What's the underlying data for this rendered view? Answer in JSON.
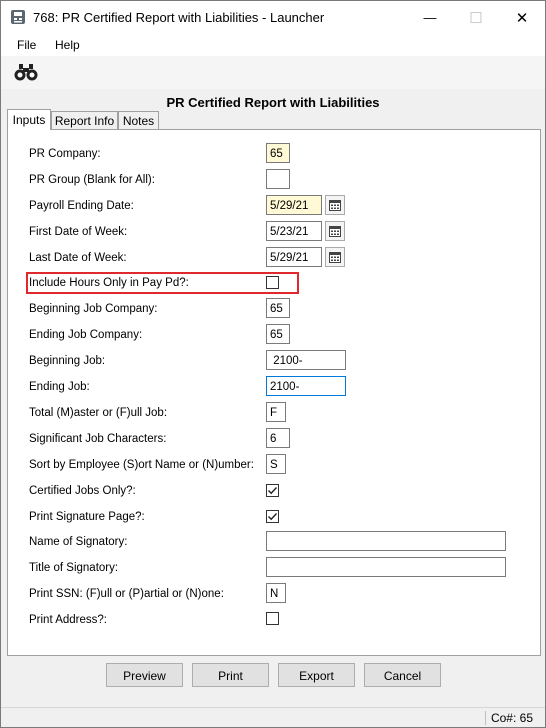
{
  "window": {
    "title": "768: PR Certified Report with Liabilities - Launcher",
    "min_glyph": "—",
    "max_glyph": "☐",
    "close_glyph": "✕"
  },
  "menu": {
    "file": "File",
    "help": "Help"
  },
  "report_title": "PR Certified Report with Liabilities",
  "tabs": [
    {
      "label": "Inputs"
    },
    {
      "label": "Report Info"
    },
    {
      "label": "Notes"
    }
  ],
  "fields": {
    "pr_company": {
      "label": "PR Company:",
      "value": "65"
    },
    "pr_group": {
      "label": "PR Group (Blank for All):",
      "value": ""
    },
    "payroll_ending_date": {
      "label": "Payroll Ending Date:",
      "value": "5/29/21"
    },
    "first_date_of_week": {
      "label": "First Date of Week:",
      "value": "5/23/21"
    },
    "last_date_of_week": {
      "label": "Last Date of Week:",
      "value": "5/29/21"
    },
    "include_hours_only": {
      "label": "Include Hours Only in Pay Pd?:",
      "checked": false
    },
    "beginning_job_company": {
      "label": "Beginning Job Company:",
      "value": "65"
    },
    "ending_job_company": {
      "label": "Ending Job Company:",
      "value": "65"
    },
    "beginning_job": {
      "label": "Beginning Job:",
      "value": " 2100-"
    },
    "ending_job": {
      "label": "Ending Job:",
      "value": "2100-"
    },
    "master_or_full_job": {
      "label": "Total (M)aster or (F)ull Job:",
      "value": "F"
    },
    "significant_job_chars": {
      "label": "Significant Job Characters:",
      "value": "6"
    },
    "sort_by_employee": {
      "label": "Sort by Employee (S)ort Name or (N)umber:",
      "value": "S"
    },
    "certified_jobs_only": {
      "label": "Certified Jobs Only?:",
      "checked": true
    },
    "print_signature_page": {
      "label": "Print Signature Page?:",
      "checked": true
    },
    "name_of_signatory": {
      "label": "Name of Signatory:",
      "value": ""
    },
    "title_of_signatory": {
      "label": "Title of Signatory:",
      "value": ""
    },
    "print_ssn": {
      "label": "Print SSN: (F)ull or (P)artial or (N)one:",
      "value": "N"
    },
    "print_address": {
      "label": "Print Address?:",
      "checked": false
    }
  },
  "buttons": {
    "preview": "Preview",
    "print": "Print",
    "export": "Export",
    "cancel": "Cancel"
  },
  "status": {
    "company": "Co#: 65"
  },
  "colors": {
    "highlight_border": "#e0282e",
    "required_field": "#fff9d6",
    "focus_border": "#0078d7"
  }
}
